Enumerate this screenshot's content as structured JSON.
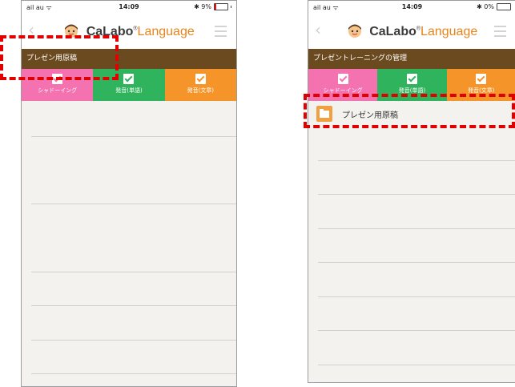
{
  "left": {
    "status": {
      "carrier": "ail au ᯤ",
      "time": "14:09",
      "battery": "✱ 9%"
    },
    "brand": {
      "calabo": "CaLabo",
      "reg": "®",
      "language": "Language"
    },
    "title": "プレゼン用原稿",
    "modes": [
      {
        "label": "シャドーイング",
        "color": "#f472b0"
      },
      {
        "label": "発音(単語)",
        "color": "#2fb35c"
      },
      {
        "label": "発音(文章)",
        "color": "#f59428"
      }
    ]
  },
  "right": {
    "status": {
      "carrier": "ail au ᯤ",
      "time": "14:09",
      "battery": "✱ 0%"
    },
    "brand": {
      "calabo": "CaLabo",
      "reg": "®",
      "language": "Language"
    },
    "title": "プレゼントレーニングの管理",
    "modes": [
      {
        "label": "シャドーイング",
        "color": "#f472b0"
      },
      {
        "label": "発音(単語)",
        "color": "#2fb35c"
      },
      {
        "label": "発音(文章)",
        "color": "#f59428"
      }
    ],
    "folder": {
      "label": "プレゼン用原稿",
      "icon": "folder-icon"
    }
  },
  "colors": {
    "titlebar": "#6b4a1f",
    "accent": "#e8841a",
    "highlight": "#e00000"
  }
}
